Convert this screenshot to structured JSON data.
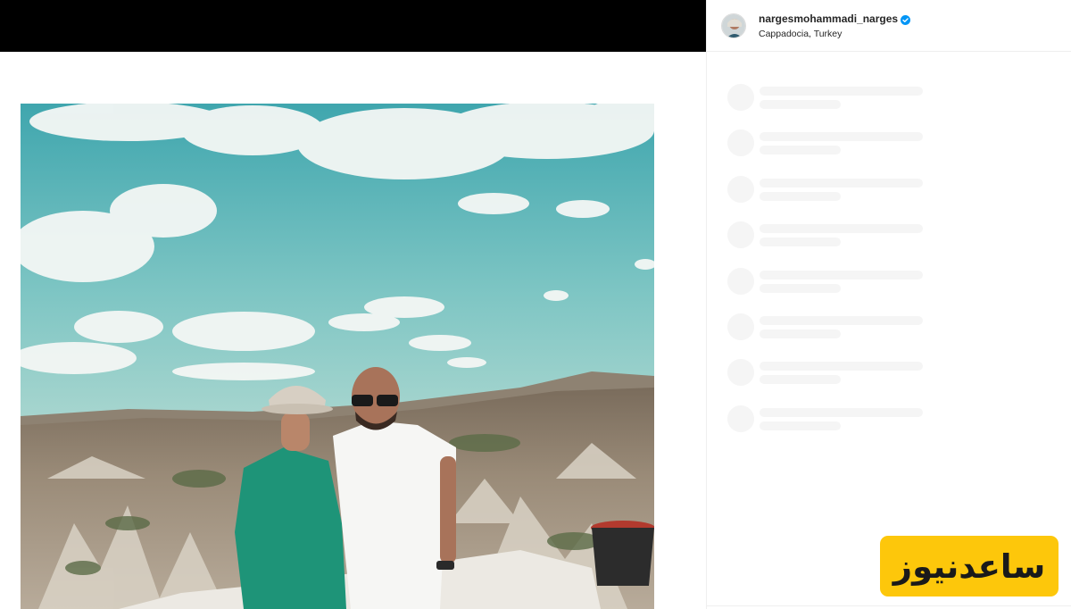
{
  "post": {
    "username": "nargesmohammadi_narges",
    "location": "Cappadocia, Turkey",
    "verified_icon": "verified-badge-icon",
    "verified_color": "#0095f6"
  },
  "comments_loading": {
    "placeholder_rows": 8
  },
  "watermark": {
    "text": "ساعدنیوز",
    "background": "#fdc70b"
  },
  "photo": {
    "description_icon": "post-photo"
  }
}
